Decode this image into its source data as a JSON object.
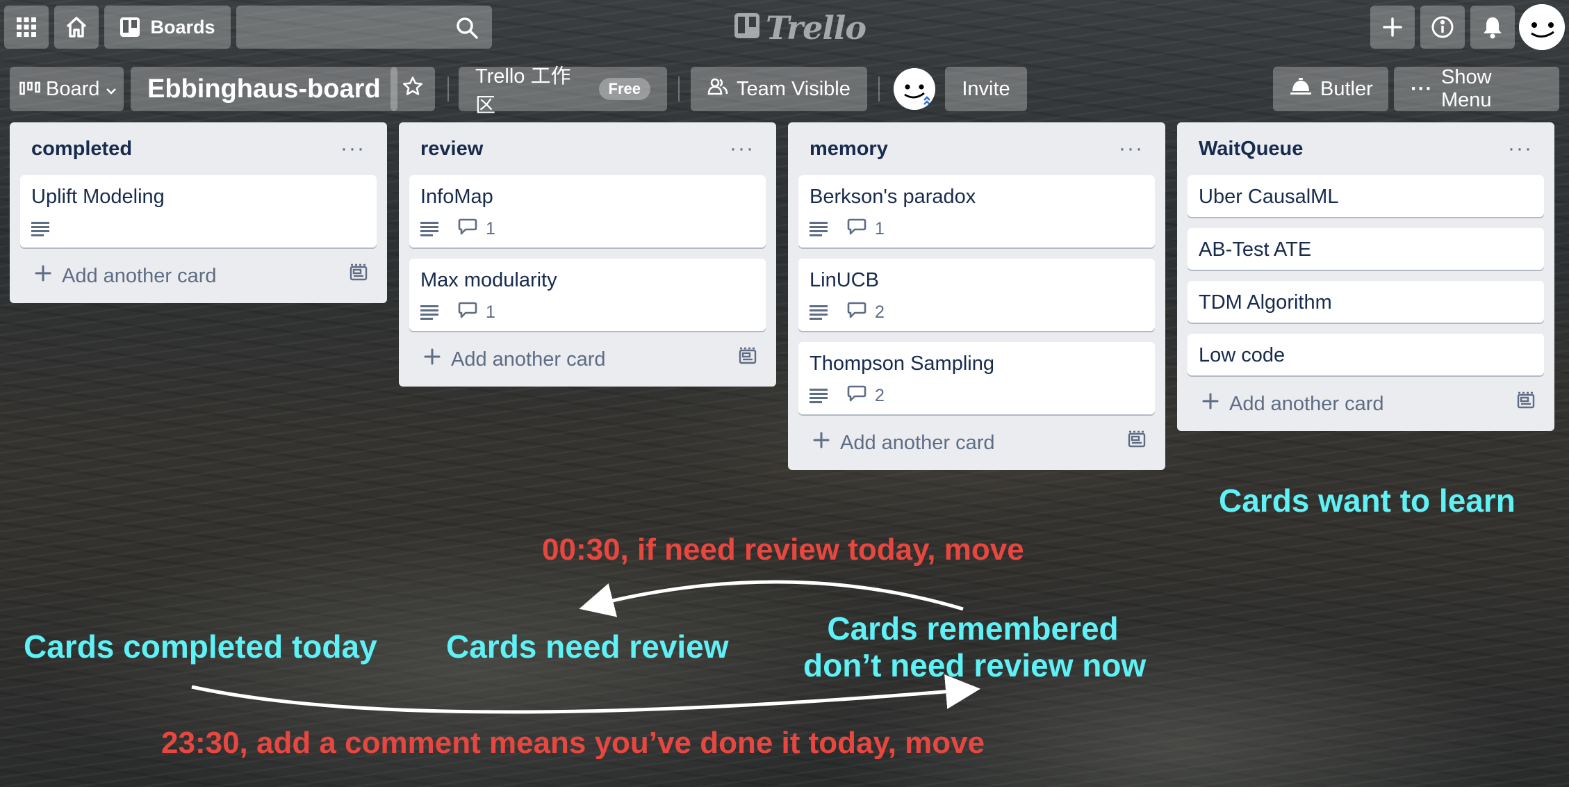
{
  "topbar": {
    "boards_label": "Boards",
    "search_placeholder": "",
    "logo_text": "Trello",
    "icons": [
      "apps-icon",
      "home-icon",
      "boards-icon",
      "search-icon",
      "plus-icon",
      "info-icon",
      "bell-icon"
    ]
  },
  "board_header": {
    "view_label": "Board",
    "title": "Ebbinghaus-board",
    "workspace_label": "Trello 工作区",
    "plan_badge": "Free",
    "visibility_label": "Team Visible",
    "invite_label": "Invite",
    "butler_label": "Butler",
    "menu_label": "Show Menu"
  },
  "add_card_label": "Add another card",
  "lists": [
    {
      "title": "completed",
      "cards": [
        {
          "title": "Uplift Modeling",
          "has_description": true,
          "comments": ""
        }
      ]
    },
    {
      "title": "review",
      "cards": [
        {
          "title": "InfoMap",
          "has_description": true,
          "comments": "1"
        },
        {
          "title": "Max modularity",
          "has_description": true,
          "comments": "1"
        }
      ]
    },
    {
      "title": "memory",
      "cards": [
        {
          "title": "Berkson's paradox",
          "has_description": true,
          "comments": "1"
        },
        {
          "title": "LinUCB",
          "has_description": true,
          "comments": "2"
        },
        {
          "title": "Thompson Sampling",
          "has_description": true,
          "comments": "2"
        }
      ]
    },
    {
      "title": "WaitQueue",
      "cards": [
        {
          "title": "Uber CausalML",
          "has_description": false,
          "comments": ""
        },
        {
          "title": "AB-Test ATE",
          "has_description": false,
          "comments": ""
        },
        {
          "title": "TDM Algorithm",
          "has_description": false,
          "comments": ""
        },
        {
          "title": "Low code",
          "has_description": false,
          "comments": ""
        }
      ]
    }
  ],
  "annotations": {
    "waitqueue_note": "Cards want to learn",
    "morning_move": "00:30, if need review today, move",
    "completed_note": "Cards completed today",
    "review_note": "Cards need review",
    "memory_note_line1": "Cards remembered",
    "memory_note_line2": "don’t need review now",
    "night_move": "23:30, add a comment means you’ve done it today, move"
  },
  "colors": {
    "annotation_cyan": "#5ef1f5",
    "annotation_red": "#e8473f",
    "list_bg": "#ebecf0",
    "card_text": "#172b4d"
  }
}
